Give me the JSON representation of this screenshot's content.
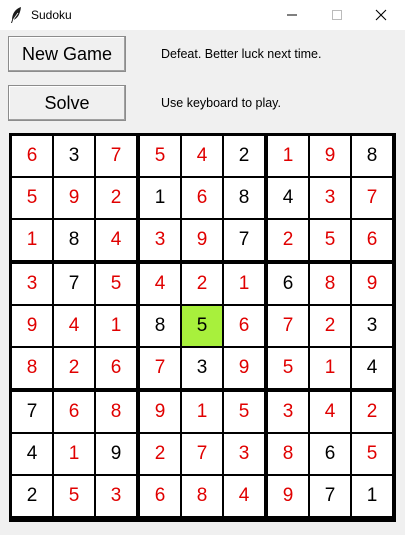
{
  "window": {
    "title": "Sudoku",
    "icon": "feather-icon"
  },
  "controls": {
    "new_game_label": "New Game",
    "solve_label": "Solve",
    "status_message": "Defeat. Better luck next time.",
    "hint_message": "Use keyboard to play."
  },
  "colors": {
    "entered": "#e00000",
    "given": "#000000",
    "selected_bg": "#a8f03c"
  },
  "selected_cell": [
    4,
    4
  ],
  "board": [
    [
      {
        "v": "6",
        "g": false
      },
      {
        "v": "3",
        "g": true
      },
      {
        "v": "7",
        "g": false
      },
      {
        "v": "5",
        "g": false
      },
      {
        "v": "4",
        "g": false
      },
      {
        "v": "2",
        "g": true
      },
      {
        "v": "1",
        "g": false
      },
      {
        "v": "9",
        "g": false
      },
      {
        "v": "8",
        "g": true
      }
    ],
    [
      {
        "v": "5",
        "g": false
      },
      {
        "v": "9",
        "g": false
      },
      {
        "v": "2",
        "g": false
      },
      {
        "v": "1",
        "g": true
      },
      {
        "v": "6",
        "g": false
      },
      {
        "v": "8",
        "g": true
      },
      {
        "v": "4",
        "g": true
      },
      {
        "v": "3",
        "g": false
      },
      {
        "v": "7",
        "g": false
      }
    ],
    [
      {
        "v": "1",
        "g": false
      },
      {
        "v": "8",
        "g": true
      },
      {
        "v": "4",
        "g": false
      },
      {
        "v": "3",
        "g": false
      },
      {
        "v": "9",
        "g": false
      },
      {
        "v": "7",
        "g": true
      },
      {
        "v": "2",
        "g": false
      },
      {
        "v": "5",
        "g": false
      },
      {
        "v": "6",
        "g": false
      }
    ],
    [
      {
        "v": "3",
        "g": false
      },
      {
        "v": "7",
        "g": true
      },
      {
        "v": "5",
        "g": false
      },
      {
        "v": "4",
        "g": false
      },
      {
        "v": "2",
        "g": false
      },
      {
        "v": "1",
        "g": false
      },
      {
        "v": "6",
        "g": true
      },
      {
        "v": "8",
        "g": false
      },
      {
        "v": "9",
        "g": false
      }
    ],
    [
      {
        "v": "9",
        "g": false
      },
      {
        "v": "4",
        "g": false
      },
      {
        "v": "1",
        "g": false
      },
      {
        "v": "8",
        "g": true
      },
      {
        "v": "5",
        "g": true
      },
      {
        "v": "6",
        "g": false
      },
      {
        "v": "7",
        "g": false
      },
      {
        "v": "2",
        "g": false
      },
      {
        "v": "3",
        "g": true
      }
    ],
    [
      {
        "v": "8",
        "g": false
      },
      {
        "v": "2",
        "g": false
      },
      {
        "v": "6",
        "g": false
      },
      {
        "v": "7",
        "g": false
      },
      {
        "v": "3",
        "g": true
      },
      {
        "v": "9",
        "g": false
      },
      {
        "v": "5",
        "g": false
      },
      {
        "v": "1",
        "g": false
      },
      {
        "v": "4",
        "g": true
      }
    ],
    [
      {
        "v": "7",
        "g": true
      },
      {
        "v": "6",
        "g": false
      },
      {
        "v": "8",
        "g": false
      },
      {
        "v": "9",
        "g": false
      },
      {
        "v": "1",
        "g": false
      },
      {
        "v": "5",
        "g": false
      },
      {
        "v": "3",
        "g": false
      },
      {
        "v": "4",
        "g": false
      },
      {
        "v": "2",
        "g": false
      }
    ],
    [
      {
        "v": "4",
        "g": true
      },
      {
        "v": "1",
        "g": false
      },
      {
        "v": "9",
        "g": true
      },
      {
        "v": "2",
        "g": false
      },
      {
        "v": "7",
        "g": false
      },
      {
        "v": "3",
        "g": false
      },
      {
        "v": "8",
        "g": false
      },
      {
        "v": "6",
        "g": true
      },
      {
        "v": "5",
        "g": false
      }
    ],
    [
      {
        "v": "2",
        "g": true
      },
      {
        "v": "5",
        "g": false
      },
      {
        "v": "3",
        "g": false
      },
      {
        "v": "6",
        "g": false
      },
      {
        "v": "8",
        "g": false
      },
      {
        "v": "4",
        "g": false
      },
      {
        "v": "9",
        "g": false
      },
      {
        "v": "7",
        "g": true
      },
      {
        "v": "1",
        "g": true
      }
    ]
  ]
}
